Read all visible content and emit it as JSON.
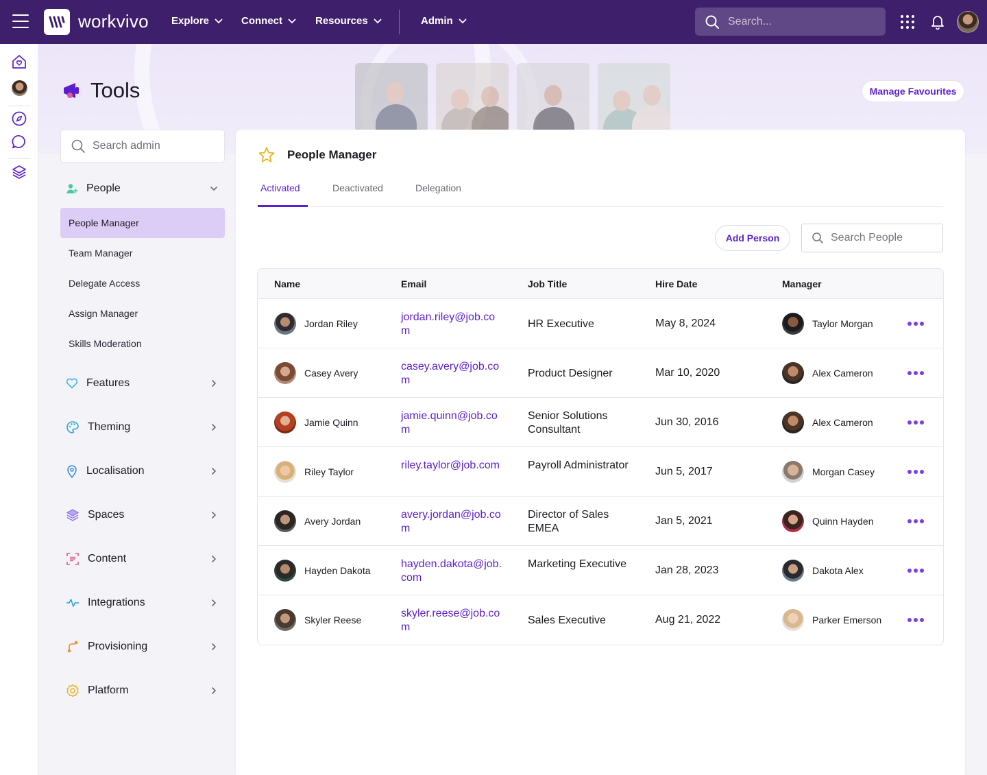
{
  "topbar": {
    "brand": "workvivo",
    "nav": [
      {
        "label": "Explore"
      },
      {
        "label": "Connect"
      },
      {
        "label": "Resources"
      },
      {
        "label": "Admin"
      }
    ],
    "search_placeholder": "Search..."
  },
  "header": {
    "title": "Tools",
    "manage_favourites": "Manage Favourites"
  },
  "sidebar": {
    "search_placeholder": "Search admin",
    "people_group": "People",
    "people_items": [
      {
        "label": "People Manager",
        "active": true
      },
      {
        "label": "Team Manager"
      },
      {
        "label": "Delegate Access"
      },
      {
        "label": "Assign Manager"
      },
      {
        "label": "Skills Moderation"
      }
    ],
    "groups": [
      {
        "label": "Features",
        "icon": "heart-icon",
        "color": "#3fb6e8"
      },
      {
        "label": "Theming",
        "icon": "palette-icon",
        "color": "#2aa7d6"
      },
      {
        "label": "Localisation",
        "icon": "location-pin-icon",
        "color": "#3b8ee0"
      },
      {
        "label": "Spaces",
        "icon": "layers-icon",
        "color": "#8a6ee8"
      },
      {
        "label": "Content",
        "icon": "content-scan-icon",
        "color": "#e45c8c"
      },
      {
        "label": "Integrations",
        "icon": "pulse-icon",
        "color": "#2f9fd8"
      },
      {
        "label": "Provisioning",
        "icon": "route-icon",
        "color": "#f08a2a"
      },
      {
        "label": "Platform",
        "icon": "gear-icon",
        "color": "#e8b21f"
      }
    ]
  },
  "main": {
    "title": "People Manager",
    "tabs": [
      "Activated",
      "Deactivated",
      "Delegation"
    ],
    "add_person": "Add Person",
    "search_placeholder": "Search People",
    "columns": [
      "Name",
      "Email",
      "Job Title",
      "Hire Date",
      "Manager"
    ],
    "rows": [
      {
        "name": "Jordan Riley",
        "email": "jordan.riley@job.com",
        "job": "HR Executive",
        "date": "May 8, 2024",
        "manager": "Taylor Morgan"
      },
      {
        "name": "Casey Avery",
        "email": "casey.avery@job.com",
        "job": "Product Designer",
        "date": "Mar 10, 2020",
        "manager": "Alex Cameron"
      },
      {
        "name": "Jamie Quinn",
        "email": "jamie.quinn@job.com",
        "job": "Senior Solutions Consultant",
        "date": "Jun 30, 2016",
        "manager": "Alex Cameron"
      },
      {
        "name": "Riley Taylor",
        "email": "riley.taylor@job.com",
        "job": "Payroll Administrator",
        "date": "Jun 5, 2017",
        "manager": "Morgan Casey"
      },
      {
        "name": "Avery Jordan",
        "email": "avery.jordan@job.com",
        "job": "Director of Sales EMEA",
        "date": "Jan 5, 2021",
        "manager": "Quinn Hayden"
      },
      {
        "name": "Hayden Dakota",
        "email": "hayden.dakota@job.com",
        "job": "Marketing Executive",
        "date": "Jan 28, 2023",
        "manager": "Dakota Alex"
      },
      {
        "name": "Skyler Reese",
        "email": "skyler.reese@job.com",
        "job": "Sales Executive",
        "date": "Aug 21, 2022",
        "manager": "Parker Emerson"
      }
    ]
  },
  "colors": {
    "topbar": "#3e1f6b",
    "accent": "#5b1fcf",
    "active_item": "#dccdf6"
  }
}
